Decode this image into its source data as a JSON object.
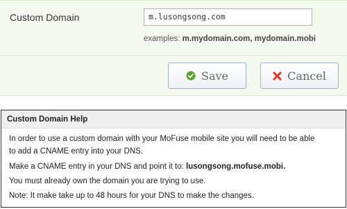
{
  "form": {
    "label": "Custom Domain",
    "domain_value": "m.lusongsong.com",
    "examples_prefix": "examples:",
    "examples_value": "m.mydomain.com, mydomain.mobi",
    "save_label": "Save",
    "cancel_label": "Cancel",
    "save_icon": "check-circle-icon",
    "cancel_icon": "x-icon"
  },
  "help": {
    "title": "Custom Domain Help",
    "line1": "In order to use a custom domain with your MoFuse mobile site you will need to be able",
    "line2": "to add a CNAME entry into your DNS.",
    "line3_prefix": "Make a CNAME entry in your DNS and point it to:",
    "line3_target": "lusongsong.mofuse.mobi.",
    "line4": "You must already own the domain you are trying to use.",
    "line5": "Note: It make take up to 48 hours for your DNS to make the changes."
  },
  "colors": {
    "panel_bg": "#f4f9f0",
    "save_icon_color": "#5aa02c",
    "cancel_icon_color": "#e0352b",
    "button_border": "#9bb3cf"
  }
}
